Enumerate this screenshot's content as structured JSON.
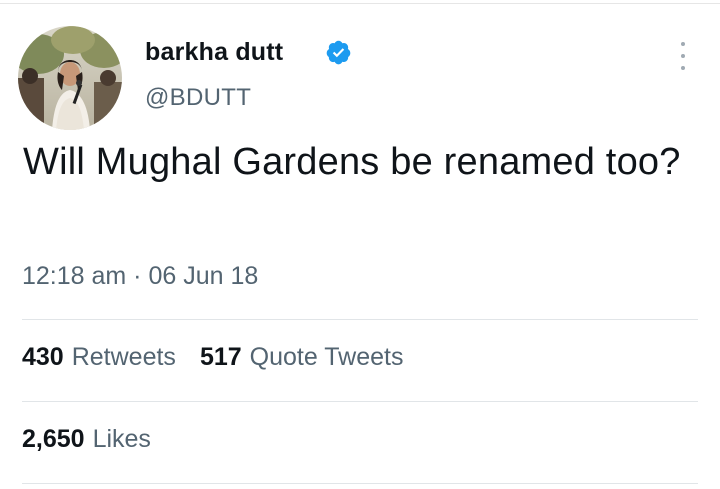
{
  "tweet": {
    "author": {
      "display_name": "barkha dutt",
      "handle": "@BDUTT",
      "verified": true
    },
    "text": "Will Mughal Gardens be renamed too?",
    "timestamp": "12:18 am · 06 Jun 18",
    "stats": {
      "retweets": {
        "count": "430",
        "label": "Retweets"
      },
      "quote_tweets": {
        "count": "517",
        "label": "Quote Tweets"
      },
      "likes": {
        "count": "2,650",
        "label": "Likes"
      }
    }
  },
  "icons": {
    "verified": "verified-badge-icon",
    "more": "more-options-icon"
  },
  "colors": {
    "verified_blue": "#1d9bf0",
    "primary_text": "#0f1419",
    "secondary_text": "#536471",
    "divider": "#e1e5e8"
  }
}
